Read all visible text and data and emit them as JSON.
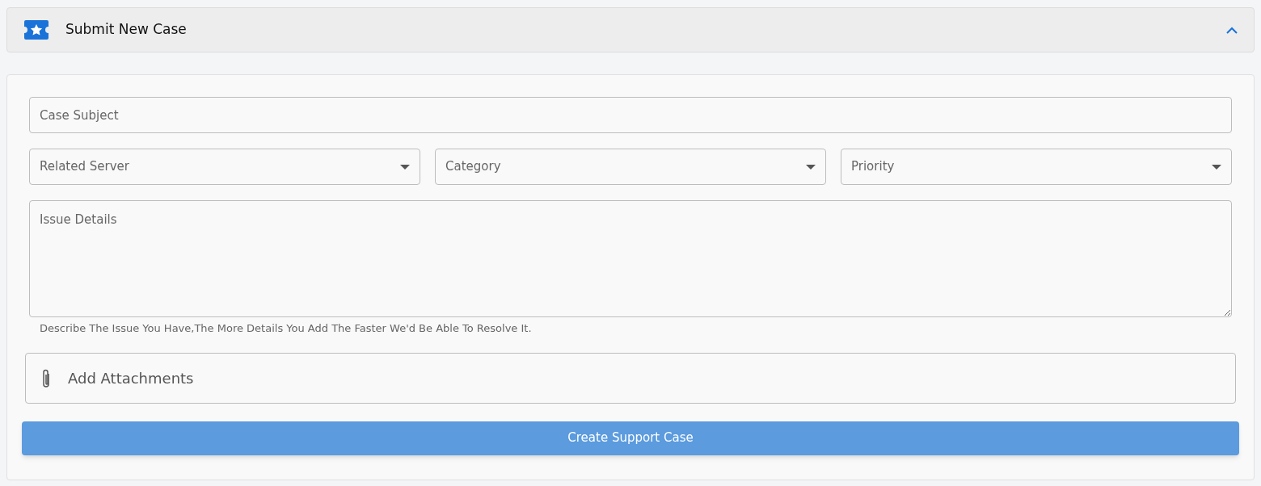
{
  "panel": {
    "title": "Submit New Case",
    "expanded": true
  },
  "form": {
    "subject": {
      "placeholder": "Case Subject"
    },
    "selects": [
      {
        "placeholder": "Related Server"
      },
      {
        "placeholder": "Category"
      },
      {
        "placeholder": "Priority"
      }
    ],
    "details": {
      "placeholder": "Issue Details",
      "hint": "Describe The Issue You Have,The More Details You Add The Faster We'd Be Able To Resolve It."
    },
    "attachments": {
      "label": "Add Attachments"
    },
    "submit": "Create Support Case"
  }
}
